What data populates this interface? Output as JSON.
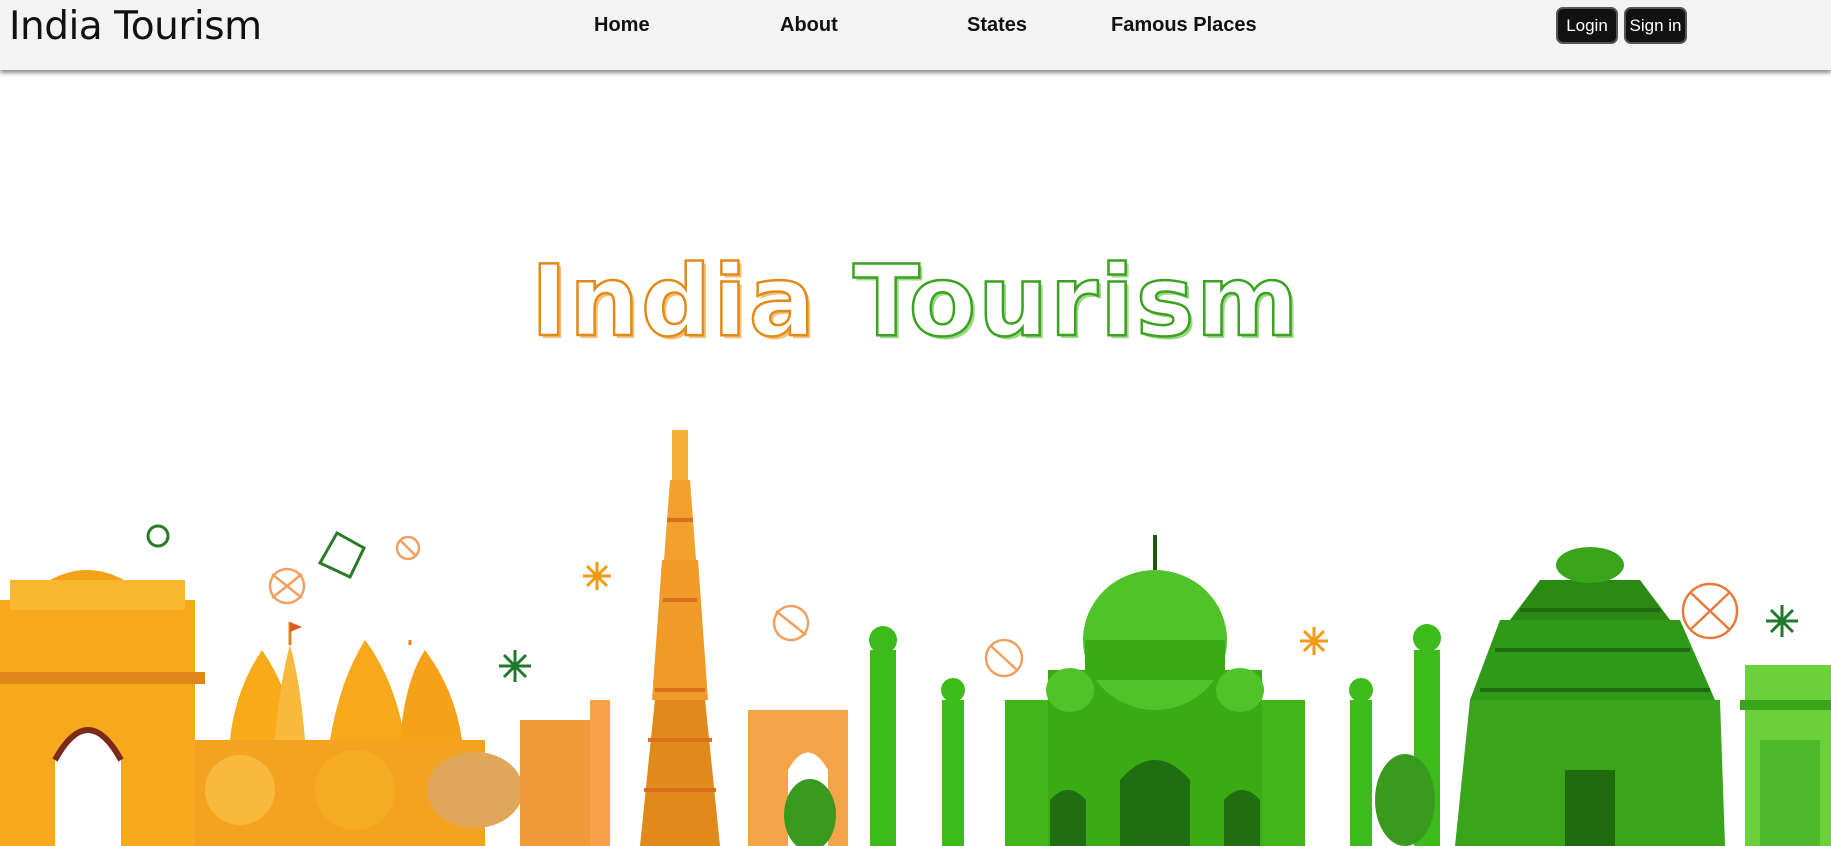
{
  "header": {
    "brand": "India Tourism",
    "nav": [
      {
        "label": "Home"
      },
      {
        "label": "About"
      },
      {
        "label": "States"
      },
      {
        "label": "Famous Places"
      }
    ],
    "login_label": "Login",
    "signin_label": "Sign in"
  },
  "hero": {
    "title_word1": "India",
    "title_word2": "Tourism"
  },
  "colors": {
    "saffron": "#f29a12",
    "green": "#3dbb1a",
    "button_bg": "#111111",
    "navbar_bg": "#f3f3f3"
  },
  "icons": [
    "india-gate-icon",
    "temple-icon",
    "qutub-minar-icon",
    "taj-mahal-icon",
    "sun-temple-icon",
    "kite-icon",
    "firework-icon"
  ]
}
